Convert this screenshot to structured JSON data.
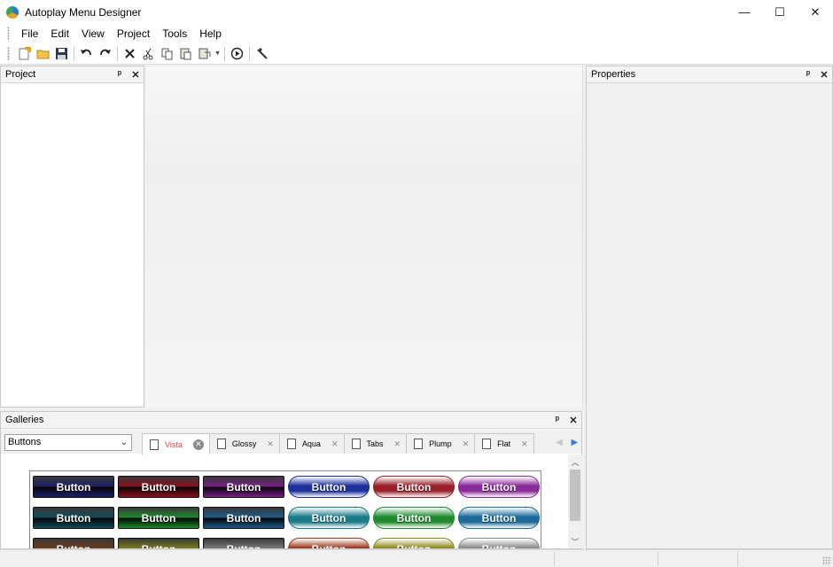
{
  "window": {
    "title": "Autoplay Menu Designer",
    "controls": {
      "minimize": "—",
      "maximize": "☐",
      "close": "✕"
    }
  },
  "menubar": {
    "items": [
      "File",
      "Edit",
      "View",
      "Project",
      "Tools",
      "Help"
    ]
  },
  "toolbar": {
    "buttons": [
      "new-icon",
      "open-folder-icon",
      "save-icon",
      "undo-icon",
      "redo-icon",
      "delete-icon",
      "cut-icon",
      "copy-icon",
      "paste-icon",
      "paste-special-icon",
      "play-icon",
      "tools-icon"
    ]
  },
  "project_panel": {
    "title": "Project",
    "pin": "ᵖ",
    "close": "✕"
  },
  "properties_panel": {
    "title": "Properties",
    "pin": "ᵖ",
    "close": "✕"
  },
  "galleries_panel": {
    "title": "Galleries",
    "pin": "ᵖ",
    "close": "✕",
    "category_select": {
      "value": "Buttons",
      "chevron": "⌄"
    },
    "tabs": [
      {
        "label": "Vista",
        "active": true,
        "close": "✕"
      },
      {
        "label": "Glossy",
        "active": false,
        "close": "✕"
      },
      {
        "label": "Aqua",
        "active": false,
        "close": "✕"
      },
      {
        "label": "Tabs",
        "active": false,
        "close": "✕"
      },
      {
        "label": "Plump",
        "active": false,
        "close": "✕"
      },
      {
        "label": "Flat",
        "active": false,
        "close": "✕"
      }
    ],
    "nav": {
      "prev": "◀",
      "next": "▶"
    },
    "buttons": [
      {
        "label": "Button",
        "style": "sq",
        "color": "#1a1f6b"
      },
      {
        "label": "Button",
        "style": "sq",
        "color": "#8a0f1c"
      },
      {
        "label": "Button",
        "style": "sq",
        "color": "#7a1f8a"
      },
      {
        "label": "Button",
        "style": "pill",
        "color": "#1c2f9a"
      },
      {
        "label": "Button",
        "style": "pill",
        "color": "#9a1f2a"
      },
      {
        "label": "Button",
        "style": "pill",
        "color": "#8a2a9a"
      },
      {
        "label": "Button",
        "style": "sq",
        "color": "#0f4a5a"
      },
      {
        "label": "Button",
        "style": "sq",
        "color": "#1a8a2a"
      },
      {
        "label": "Button",
        "style": "sq",
        "color": "#1a5a8a"
      },
      {
        "label": "Button",
        "style": "pill",
        "color": "#1a7a8a"
      },
      {
        "label": "Button",
        "style": "pill",
        "color": "#1f8a2f"
      },
      {
        "label": "Button",
        "style": "pill",
        "color": "#1a6a9a"
      },
      {
        "label": "Button",
        "style": "sq",
        "color": "#6a3a1a"
      },
      {
        "label": "Button",
        "style": "sq",
        "color": "#7a7a1a"
      },
      {
        "label": "Button",
        "style": "sq",
        "color": "#7a7a7a"
      },
      {
        "label": "Button",
        "style": "pill",
        "color": "#9a3a1a"
      },
      {
        "label": "Button",
        "style": "pill",
        "color": "#8a8a1a"
      },
      {
        "label": "Button",
        "style": "pill",
        "color": "#8a8a8a"
      }
    ],
    "scroll": {
      "up": "︿",
      "down": "﹀"
    }
  }
}
